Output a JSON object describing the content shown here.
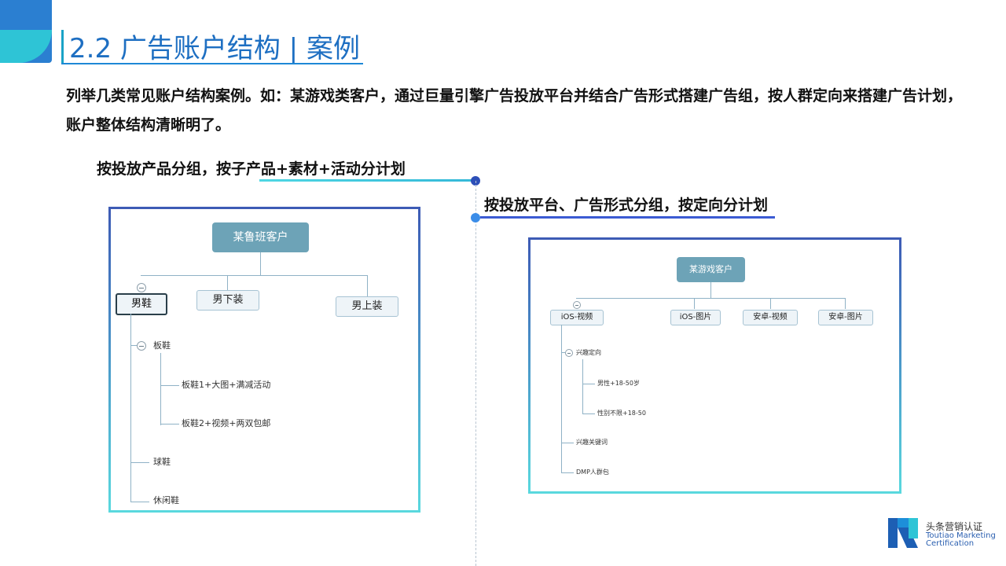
{
  "title": "2.2 广告账户结构 | 案例",
  "paragraph": "列举几类常见账户结构案例。如：某游戏类客户，通过巨量引擎广告投放平台并结合广告形式搭建广告组，按人群定向来搭建广告计划，账户整体结构清晰明了。",
  "left": {
    "heading": "按投放产品分组，按子产品+素材+活动分计划",
    "root": "某鲁班客户",
    "groups": [
      "男鞋",
      "男下装",
      "男上装"
    ],
    "sub": "板鞋",
    "leaves": [
      "板鞋1+大图+满减活动",
      "板鞋2+视频+两双包邮"
    ],
    "others": [
      "球鞋",
      "休闲鞋"
    ]
  },
  "right": {
    "heading": "按投放平台、广告形式分组，按定向分计划",
    "root": "某游戏客户",
    "groups": [
      "iOS-视频",
      "iOS-图片",
      "安卓-视频",
      "安卓-图片"
    ],
    "sub": "兴趣定向",
    "leaves": [
      "男性+18-50岁",
      "性别不限+18-50"
    ],
    "others": [
      "兴趣关键词",
      "DMP人群包"
    ]
  },
  "logo": {
    "cn": "头条营销认证",
    "en1": "Toutiao Marketing",
    "en2": "Certification"
  },
  "colors": {
    "accent_blue": "#1e6fc2",
    "accent_cyan": "#2ec4d6",
    "node_root": "#6da3b7"
  }
}
